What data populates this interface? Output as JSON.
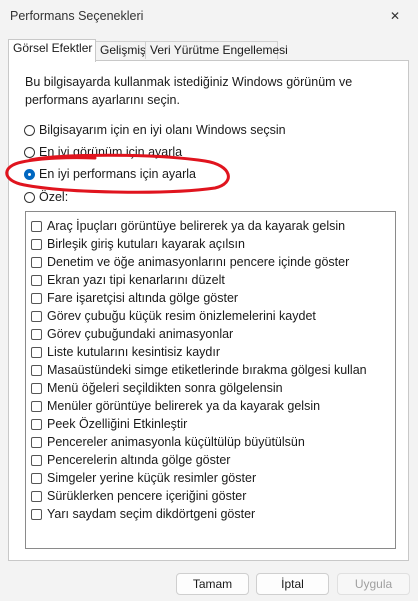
{
  "window": {
    "title": "Performans Seçenekleri",
    "close_icon": "✕"
  },
  "tabs": [
    {
      "label": "Görsel Efektler",
      "active": true
    },
    {
      "label": "Gelişmiş",
      "active": false
    },
    {
      "label": "Veri Yürütme Engellemesi",
      "active": false
    }
  ],
  "description": "Bu bilgisayarda kullanmak istediğiniz Windows görünüm ve performans ayarlarını seçin.",
  "options": [
    {
      "label": "Bilgisayarım için en iyi olanı Windows seçsin",
      "checked": false
    },
    {
      "label": "En iyi görünüm için ayarla",
      "checked": false
    },
    {
      "label": "En iyi performans için ayarla",
      "checked": true
    },
    {
      "label": "Özel:",
      "checked": false
    }
  ],
  "effects": [
    "Araç İpuçları görüntüye belirerek ya da kayarak gelsin",
    "Birleşik giriş kutuları kayarak açılsın",
    "Denetim ve öğe animasyonlarını pencere içinde göster",
    "Ekran yazı tipi kenarlarını düzelt",
    "Fare işaretçisi altında gölge göster",
    "Görev çubuğu küçük resim önizlemelerini kaydet",
    "Görev çubuğundaki animasyonlar",
    "Liste kutularını kesintisiz kaydır",
    "Masaüstündeki simge etiketlerinde bırakma gölgesi kullan",
    "Menü öğeleri seçildikten sonra gölgelensin",
    "Menüler görüntüye belirerek ya da kayarak gelsin",
    "Peek Özelliğini Etkinleştir",
    "Pencereler animasyonla küçültülüp büyütülsün",
    "Pencerelerin altında gölge göster",
    "Simgeler yerine küçük resimler göster",
    "Sürüklerken pencere içeriğini göster",
    "Yarı saydam seçim dikdörtgeni göster"
  ],
  "buttons": {
    "ok": "Tamam",
    "cancel": "İptal",
    "apply": "Uygula"
  },
  "colors": {
    "accent": "#0067c0",
    "annotation": "#e0141e"
  }
}
